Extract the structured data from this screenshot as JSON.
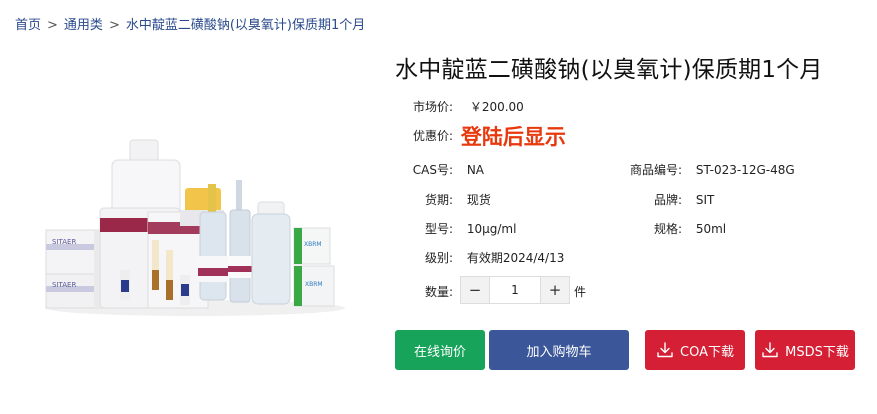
{
  "breadcrumb": {
    "home": "首页",
    "category": "通用类",
    "product": "水中靛蓝二磺酸钠(以臭氧计)保质期1个月",
    "separator": ">"
  },
  "product": {
    "title": "水中靛蓝二磺酸钠(以臭氧计)保质期1个月",
    "market_price_label": "市场价:",
    "market_price": "￥200.00",
    "promo_label": "优惠价:",
    "promo_value": "登陆后显示",
    "cas_label": "CAS号:",
    "cas": "NA",
    "code_label": "商品编号:",
    "code": "ST-023-12G-48G",
    "stock_label": "货期:",
    "stock": "现货",
    "brand_label": "品牌:",
    "brand": "SIT",
    "model_label": "型号:",
    "model": "10μg/ml",
    "spec_label": "规格:",
    "spec": "50ml",
    "grade_label": "级别:",
    "grade": "有效期2024/4/13",
    "qty_label": "数量:",
    "qty_value": "1",
    "qty_unit": "件",
    "qty_minus": "−",
    "qty_plus": "+",
    "image_labels": {
      "box_brand": "SITAER",
      "box_logo": "XBRM"
    }
  },
  "buttons": {
    "inquiry": "在线询价",
    "add_cart": "加入购物车",
    "coa": "COA下载",
    "msds": "MSDS下载"
  },
  "colors": {
    "inquiry": "#17a35a",
    "add_cart": "#3b579a",
    "download": "#d41f34",
    "promo": "#e8380d",
    "breadcrumb": "#2a4a8c"
  },
  "icons": {
    "download": "download-icon"
  }
}
